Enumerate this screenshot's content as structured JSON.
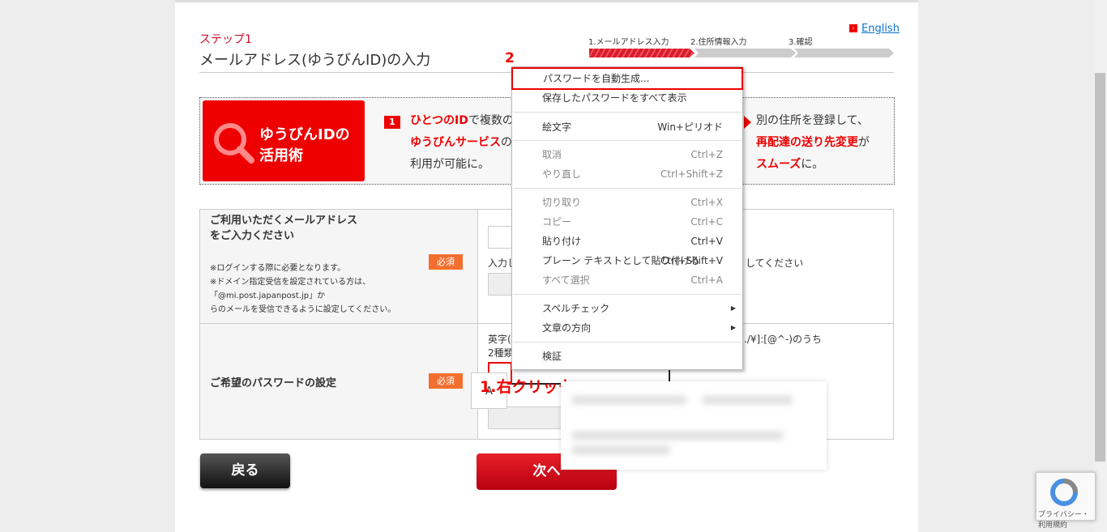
{
  "header": {
    "step_label": "ステップ1",
    "title": "メールアドレス(ゆうびんID)の入力",
    "english_link": "English",
    "progress": [
      {
        "label": "1.メールアドレス入力",
        "active": true
      },
      {
        "label": "2.住所情報入力",
        "active": false
      },
      {
        "label": "3.確認",
        "active": false
      }
    ]
  },
  "banner": {
    "badge_title_1": "ゆうびんIDの",
    "badge_title_2": "活用術",
    "item1_num": "1",
    "item1_red1": "ひとつのID",
    "item1_text1": "で複数の",
    "item1_red2": "ゆうびんサービス",
    "item1_text2": "の",
    "item1_text3": "利用が可能に。",
    "item2_text1": "別の住所を登録して、",
    "item2_red1": "再配達の送り先変更",
    "item2_text2": "が",
    "item2_red2": "スムーズ",
    "item2_text3": "に。"
  },
  "form": {
    "email_label_1": "ご利用いただくメールアドレス",
    "email_label_2": "をご入力ください",
    "required": "必須",
    "email_note_1": "※ログインする際に必要となります。",
    "email_note_2": "※ドメイン指定受信を設定されている方は、「@mi.post.japanpost.jp」か",
    "email_note_3": "らのメールを受信できるように設定してください。",
    "email_hint_left": "入力し",
    "email_hint_right": "してください",
    "password_label": "ご希望のパスワードの設定",
    "password_hint_1_left": "英字(",
    "password_hint_1_right": "く./¥]:[@^-)のうち",
    "password_hint_2_left": "2種類"
  },
  "buttons": {
    "back": "戻る",
    "next": "次へ"
  },
  "annotations": {
    "step1": "1.右クリック",
    "step2": "2"
  },
  "context_menu": {
    "items": [
      {
        "label": "パスワードを自動生成...",
        "shortcut": "",
        "disabled": false,
        "highlighted": true
      },
      {
        "label": "保存したパスワードをすべて表示",
        "shortcut": "",
        "disabled": false
      },
      {
        "label": "絵文字",
        "shortcut": "Win+ピリオド",
        "disabled": false
      },
      {
        "label": "取消",
        "shortcut": "Ctrl+Z",
        "disabled": true
      },
      {
        "label": "やり直し",
        "shortcut": "Ctrl+Shift+Z",
        "disabled": true
      },
      {
        "label": "切り取り",
        "shortcut": "Ctrl+X",
        "disabled": true
      },
      {
        "label": "コピー",
        "shortcut": "Ctrl+C",
        "disabled": true
      },
      {
        "label": "貼り付け",
        "shortcut": "Ctrl+V",
        "disabled": false
      },
      {
        "label": "プレーン テキストとして貼り付ける",
        "shortcut": "Ctrl+Shift+V",
        "disabled": false
      },
      {
        "label": "すべて選択",
        "shortcut": "Ctrl+A",
        "disabled": true
      },
      {
        "label": "スペルチェック",
        "shortcut": "",
        "disabled": false,
        "submenu": true
      },
      {
        "label": "文章の方向",
        "shortcut": "",
        "disabled": false,
        "submenu": true
      },
      {
        "label": "検証",
        "shortcut": "",
        "disabled": false
      }
    ]
  },
  "tooltip": {
    "glyph": "A"
  },
  "recaptcha": {
    "text": "プライバシー・利用規約"
  },
  "colors": {
    "accent": "#e60012",
    "required": "#f36f2f"
  }
}
